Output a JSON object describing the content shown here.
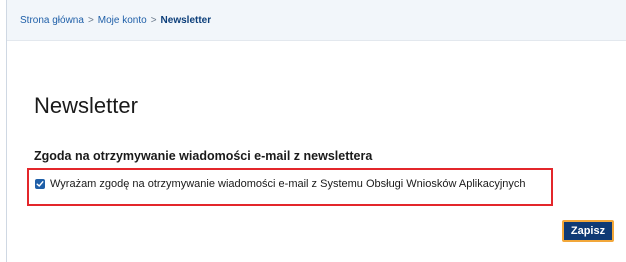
{
  "breadcrumb": {
    "items": [
      "Strona główna",
      "Moje konto",
      "Newsletter"
    ],
    "separator": ">"
  },
  "page": {
    "title": "Newsletter"
  },
  "consent": {
    "section_label": "Zgoda na otrzymywanie wiadomości e-mail z newslettera",
    "checkbox_label": "Wyrażam zgodę na otrzymywanie wiadomości e-mail z Systemu Obsługi Wniosków Aplikacyjnych",
    "checked": true
  },
  "actions": {
    "save_label": "Zapisz"
  },
  "colors": {
    "link": "#1f5fa8",
    "highlight_border": "#e3262b",
    "button_bg": "#0f3a75",
    "button_focus": "#f2a73a"
  }
}
